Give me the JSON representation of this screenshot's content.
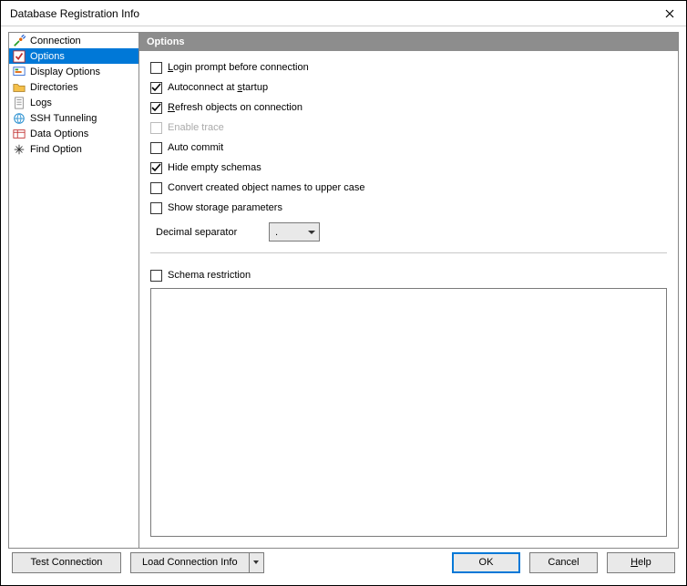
{
  "window": {
    "title": "Database Registration Info"
  },
  "sidebar": {
    "items": [
      {
        "label": "Connection",
        "icon": "connection"
      },
      {
        "label": "Options",
        "icon": "options",
        "selected": true
      },
      {
        "label": "Display Options",
        "icon": "display"
      },
      {
        "label": "Directories",
        "icon": "folder"
      },
      {
        "label": "Logs",
        "icon": "logs"
      },
      {
        "label": "SSH Tunneling",
        "icon": "ssh"
      },
      {
        "label": "Data Options",
        "icon": "data"
      },
      {
        "label": "Find Option",
        "icon": "find"
      }
    ]
  },
  "main": {
    "header": "Options",
    "checkboxes": [
      {
        "label": "Login prompt before connection",
        "checked": false,
        "disabled": false,
        "u": 0
      },
      {
        "label": "Autoconnect at startup",
        "checked": true,
        "disabled": false,
        "u": 15
      },
      {
        "label": "Refresh objects on connection",
        "checked": true,
        "disabled": false,
        "u": 0
      },
      {
        "label": "Enable trace",
        "checked": false,
        "disabled": true,
        "u": -1
      },
      {
        "label": "Auto commit",
        "checked": false,
        "disabled": false,
        "u": -1
      },
      {
        "label": "Hide empty schemas",
        "checked": true,
        "disabled": false,
        "u": -1
      },
      {
        "label": "Convert created object names to upper case",
        "checked": false,
        "disabled": false,
        "u": -1
      },
      {
        "label": "Show storage parameters",
        "checked": false,
        "disabled": false,
        "u": -1
      }
    ],
    "decimal_separator_label": "Decimal separator",
    "decimal_separator_value": ".",
    "schema_restriction": {
      "label": "Schema restriction",
      "checked": false
    }
  },
  "footer": {
    "test_connection": "Test Connection",
    "load_connection": "Load Connection Info",
    "ok": "OK",
    "cancel": "Cancel",
    "help": "Help"
  }
}
